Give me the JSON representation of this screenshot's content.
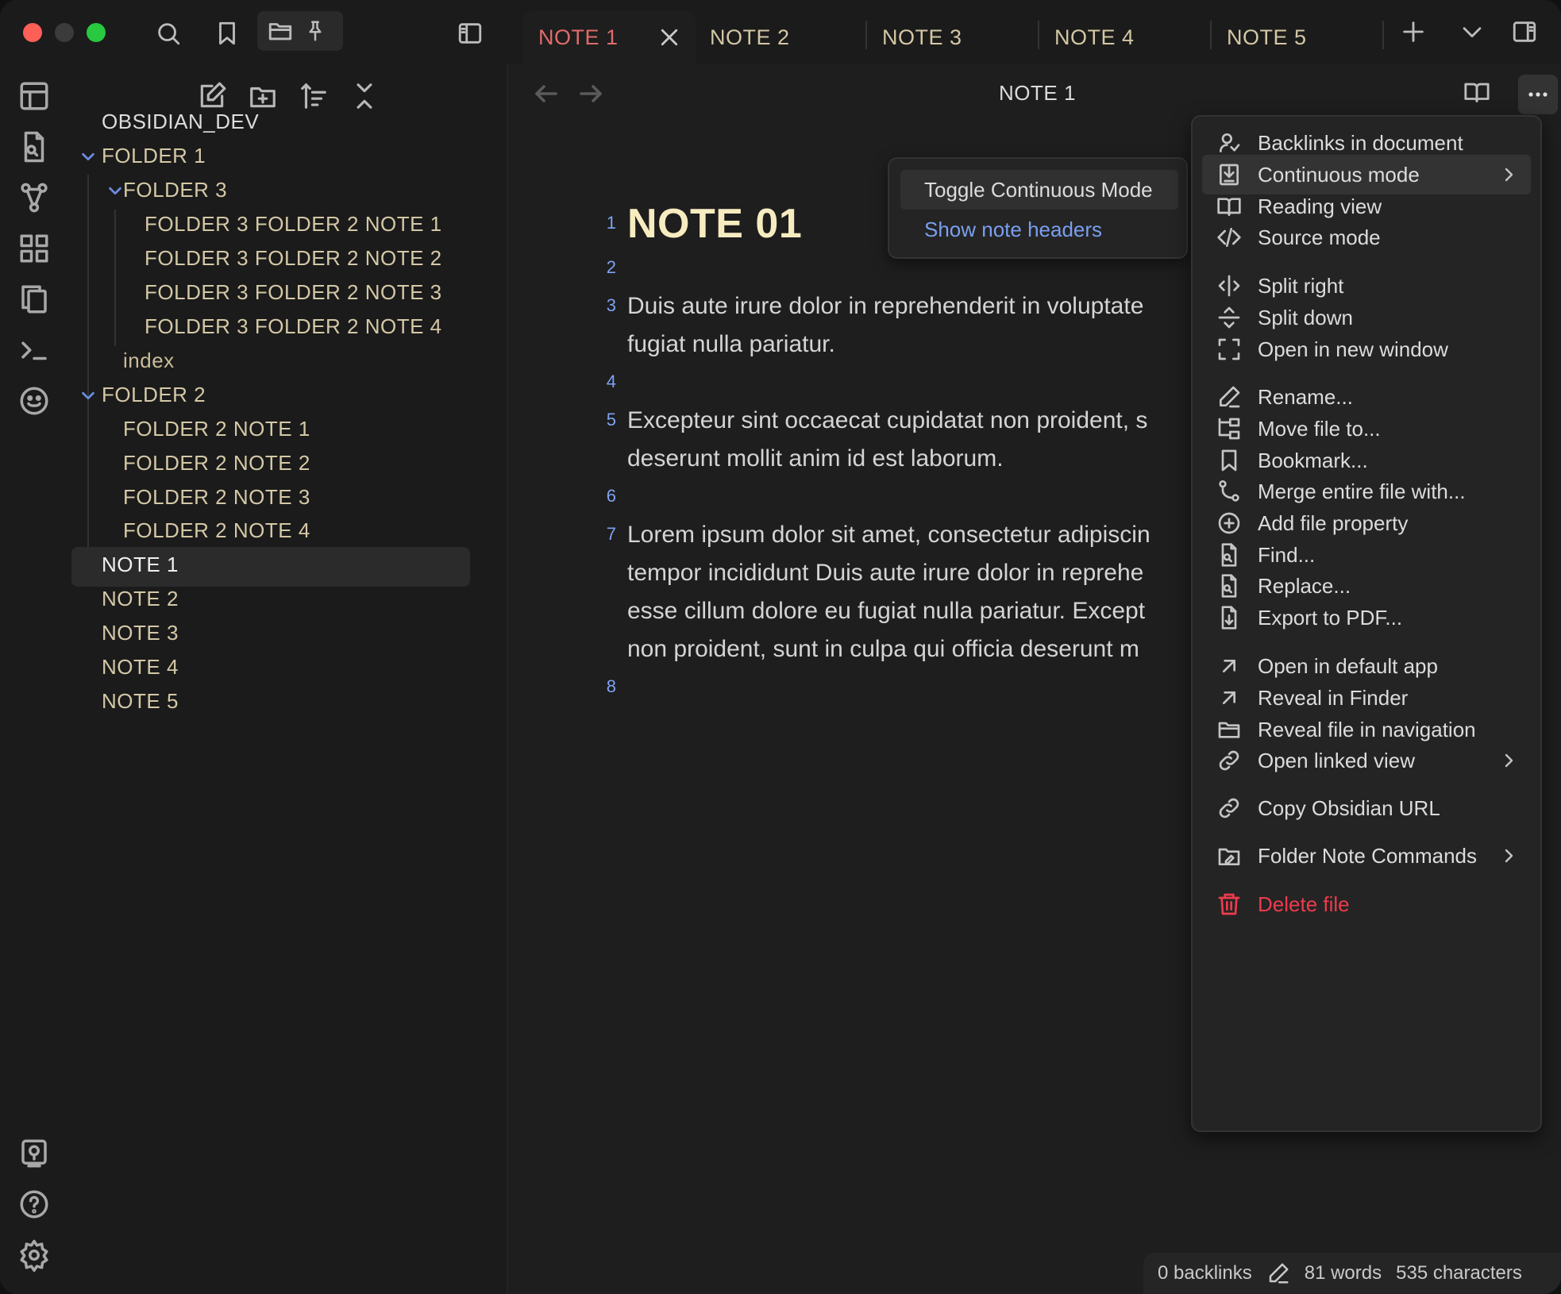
{
  "window": {
    "traffic_lights": {
      "close_color": "#fe5f57",
      "minimize_color": "#3b3b3b",
      "zoom_color": "#28c840"
    }
  },
  "tabs": [
    {
      "label": "NOTE 1",
      "active": true
    },
    {
      "label": "NOTE 2",
      "active": false
    },
    {
      "label": "NOTE 3",
      "active": false
    },
    {
      "label": "NOTE 4",
      "active": false
    },
    {
      "label": "NOTE 5",
      "active": false
    }
  ],
  "explorer": {
    "vault_name": "OBSIDIAN_DEV",
    "tree": {
      "folder1": "FOLDER 1",
      "folder3": "FOLDER 3",
      "folder3_notes": [
        "FOLDER 3 FOLDER 2 NOTE 1",
        "FOLDER 3 FOLDER 2 NOTE 2",
        "FOLDER 3 FOLDER 2 NOTE 3",
        "FOLDER 3 FOLDER 2 NOTE 4"
      ],
      "index": "index",
      "folder2": "FOLDER 2",
      "folder2_notes": [
        "FOLDER 2 NOTE 1",
        "FOLDER 2 NOTE 2",
        "FOLDER 2 NOTE 3",
        "FOLDER 2 NOTE 4"
      ],
      "root_notes": [
        "NOTE 1",
        "NOTE 2",
        "NOTE 3",
        "NOTE 4",
        "NOTE 5"
      ],
      "selected": "NOTE 1"
    }
  },
  "editor": {
    "view_title": "NOTE 1",
    "line_numbers": [
      "1",
      "2",
      "3",
      "4",
      "5",
      "6",
      "7",
      "8"
    ],
    "heading": "NOTE 01",
    "para1": [
      "Duis aute irure dolor in reprehenderit in voluptate",
      "fugiat nulla pariatur."
    ],
    "para2": [
      "Excepteur sint occaecat cupidatat non proident, s",
      "deserunt mollit anim id est laborum."
    ],
    "para3": [
      "Lorem ipsum dolor sit amet, consectetur adipiscin",
      "tempor incididunt Duis aute irure dolor in reprehe",
      "esse cillum dolore eu fugiat nulla pariatur. Except",
      "non proident, sunt in culpa qui officia deserunt m"
    ]
  },
  "submenu": {
    "toggle_label": "Toggle Continuous Mode",
    "headers_label": "Show note headers"
  },
  "context_menu": {
    "items": [
      {
        "label": "Backlinks in document",
        "icon": "backlinks-icon"
      },
      {
        "label": "Continuous mode",
        "icon": "continuous-icon",
        "submenu": true,
        "highlighted": true
      },
      {
        "label": "Reading view",
        "icon": "book-open-icon"
      },
      {
        "label": "Source mode",
        "icon": "code-icon"
      },
      {
        "label": "Split right",
        "icon": "split-right-icon"
      },
      {
        "label": "Split down",
        "icon": "split-down-icon"
      },
      {
        "label": "Open in new window",
        "icon": "maximize-icon"
      },
      {
        "label": "Rename...",
        "icon": "pencil-icon"
      },
      {
        "label": "Move file to...",
        "icon": "folder-tree-icon"
      },
      {
        "label": "Bookmark...",
        "icon": "bookmark-icon"
      },
      {
        "label": "Merge entire file with...",
        "icon": "git-merge-icon"
      },
      {
        "label": "Add file property",
        "icon": "plus-circle-icon"
      },
      {
        "label": "Find...",
        "icon": "file-search-icon"
      },
      {
        "label": "Replace...",
        "icon": "file-search-icon"
      },
      {
        "label": "Export to PDF...",
        "icon": "file-export-icon"
      },
      {
        "label": "Open in default app",
        "icon": "arrow-up-right-icon"
      },
      {
        "label": "Reveal in Finder",
        "icon": "arrow-up-right-icon"
      },
      {
        "label": "Reveal file in navigation",
        "icon": "folder-open-icon"
      },
      {
        "label": "Open linked view",
        "icon": "link-icon",
        "submenu": true
      },
      {
        "label": "Copy Obsidian URL",
        "icon": "link-icon"
      },
      {
        "label": "Folder Note Commands",
        "icon": "folder-note-icon",
        "submenu": true
      },
      {
        "label": "Delete file",
        "icon": "trash-icon",
        "danger": true
      }
    ],
    "danger_color": "#ee3b4c"
  },
  "status_bar": {
    "backlinks": "0 backlinks",
    "words": "81 words",
    "characters": "535 characters"
  },
  "colors": {
    "accent_link": "#7a9ff0",
    "heading": "#f7ecc0",
    "tab_active": "#e06b6b",
    "tree_text": "#d4c8a6"
  }
}
